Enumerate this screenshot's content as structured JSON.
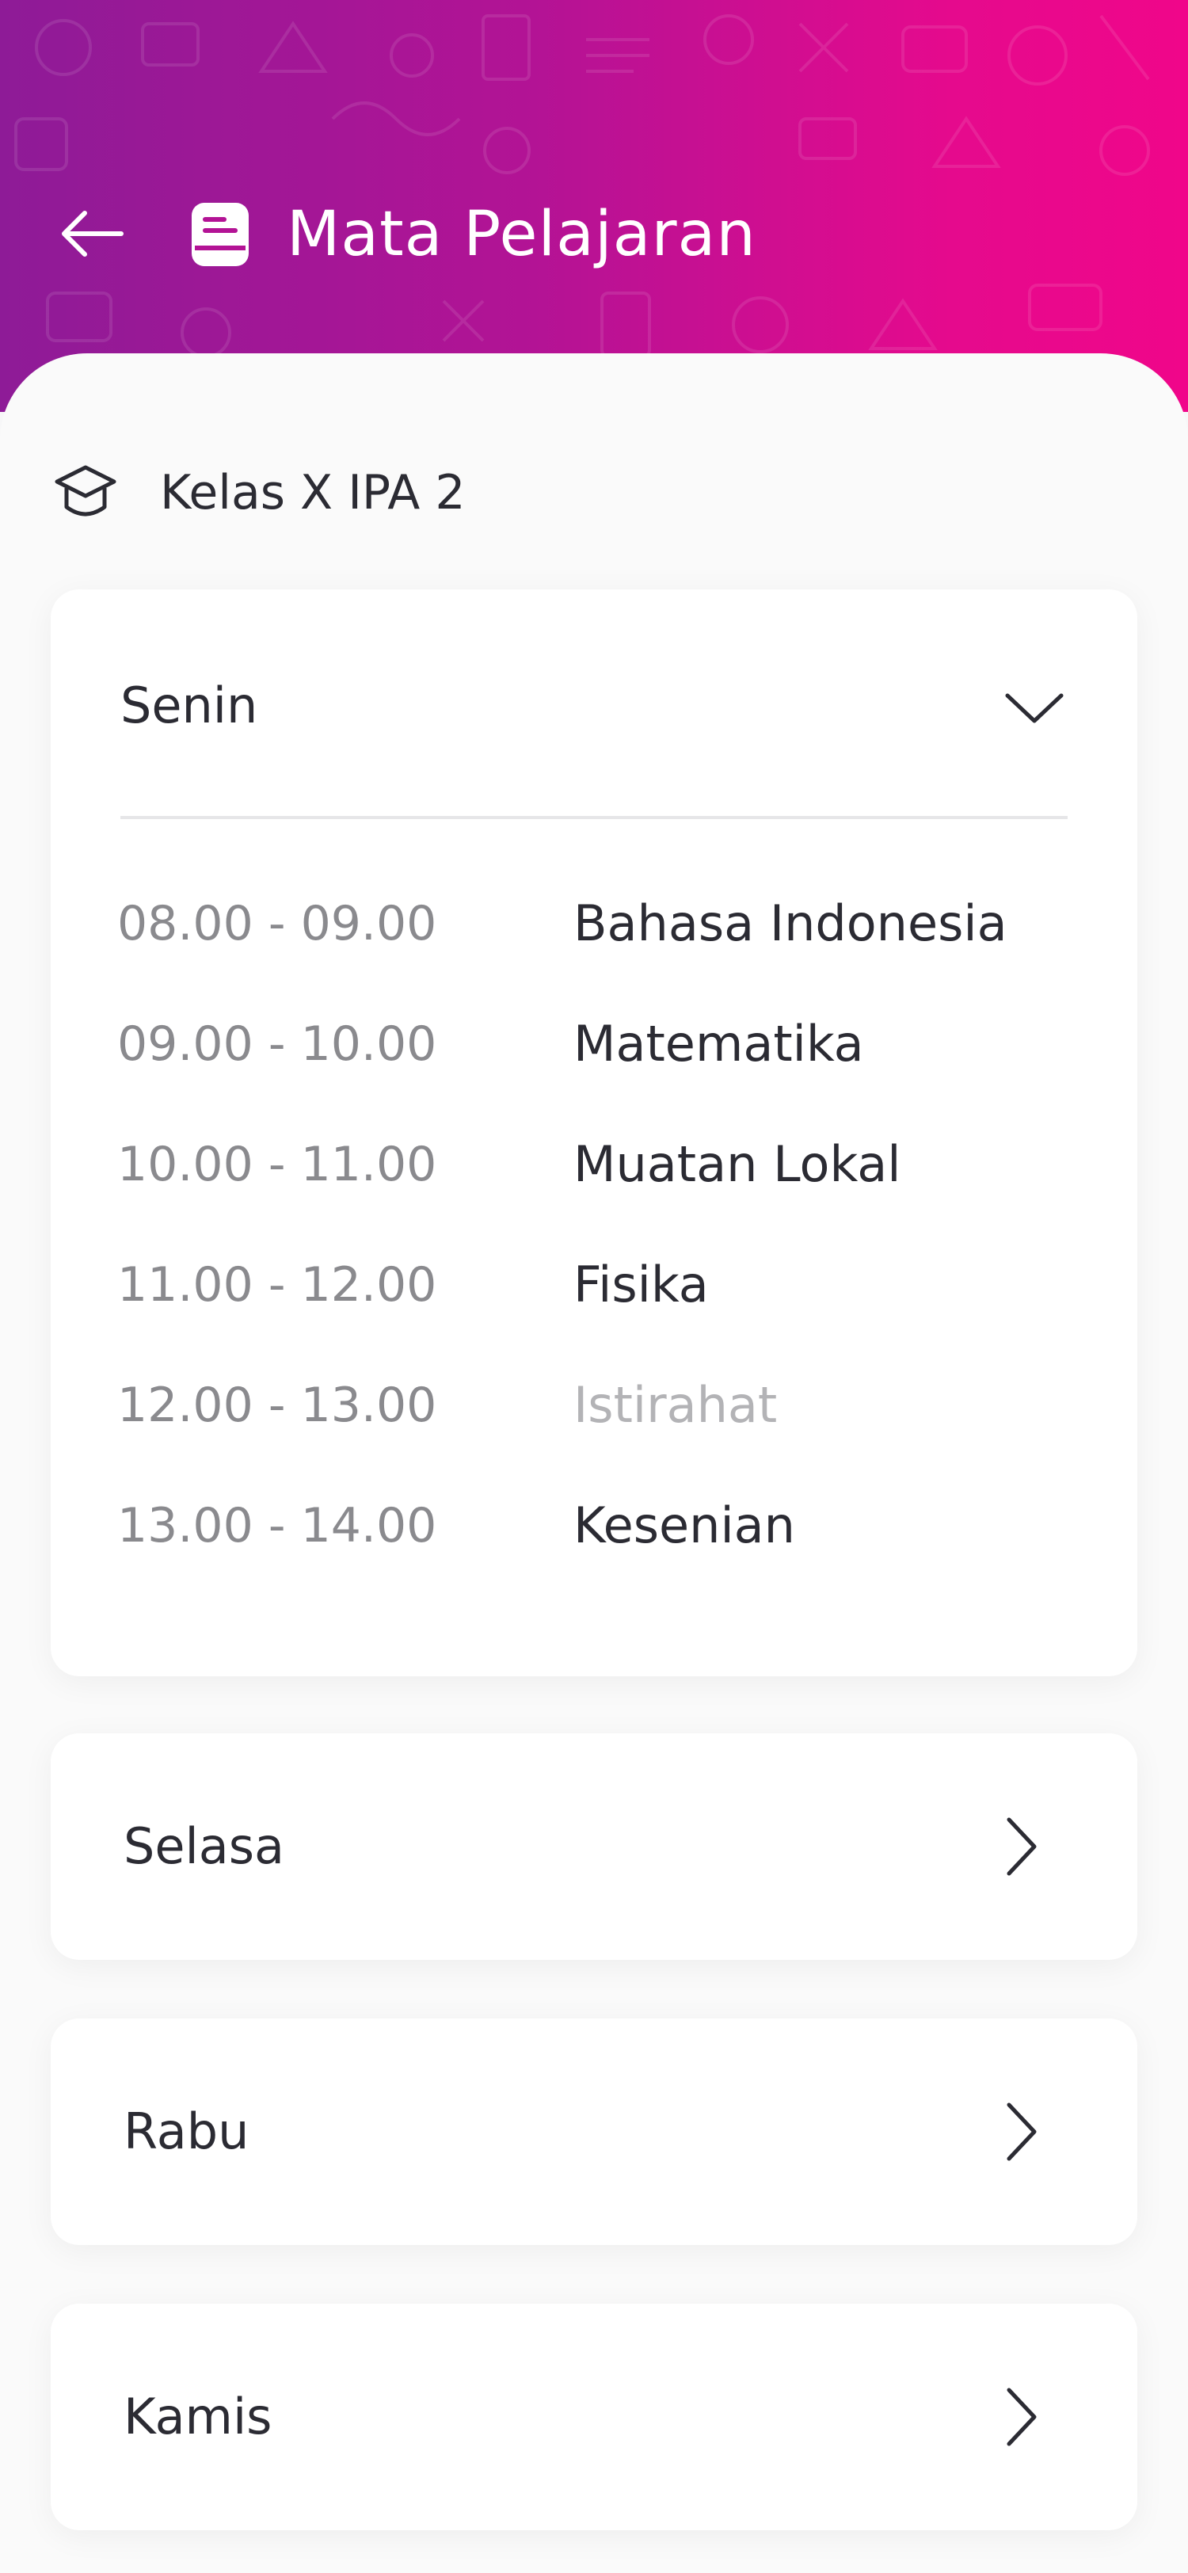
{
  "header": {
    "title": "Mata Pelajaran",
    "back_icon": "arrow-left-icon",
    "title_icon": "book-icon",
    "gradient_start": "#8e1b97",
    "gradient_end": "#f0068a"
  },
  "class_info": {
    "icon": "graduation-cap-icon",
    "label": "Kelas X IPA 2"
  },
  "days": [
    {
      "name": "Senin",
      "expanded": true,
      "icon": "chevron-down-icon",
      "schedule": [
        {
          "time": "08.00 - 09.00",
          "subject": "Bahasa Indonesia"
        },
        {
          "time": "09.00 - 10.00",
          "subject": "Matematika"
        },
        {
          "time": "10.00 - 11.00",
          "subject": "Muatan Lokal"
        },
        {
          "time": "11.00 - 12.00",
          "subject": "Fisika"
        },
        {
          "time": "12.00 - 13.00",
          "subject": "Istirahat"
        },
        {
          "time": "13.00 - 14.00",
          "subject": "Kesenian"
        }
      ]
    },
    {
      "name": "Selasa",
      "expanded": false,
      "icon": "chevron-right-icon"
    },
    {
      "name": "Rabu",
      "expanded": false,
      "icon": "chevron-right-icon"
    },
    {
      "name": "Kamis",
      "expanded": false,
      "icon": "chevron-right-icon"
    }
  ],
  "colors": {
    "text_primary": "#2b2b33",
    "text_secondary": "#8a8a8e",
    "text_muted": "#b3b3b6"
  }
}
